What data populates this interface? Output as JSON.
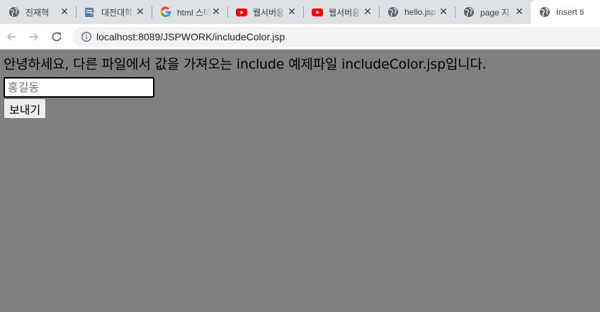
{
  "browser": {
    "tabs": [
      {
        "title": "진재혁",
        "icon": "globe-icon",
        "active": false
      },
      {
        "title": "대전대학",
        "icon": "editor-icon",
        "active": false
      },
      {
        "title": "html 스타",
        "icon": "google-icon",
        "active": false
      },
      {
        "title": "웹서버응",
        "icon": "youtube-icon",
        "active": false
      },
      {
        "title": "웹서버응",
        "icon": "youtube-icon",
        "active": false
      },
      {
        "title": "hello.jsp",
        "icon": "globe-icon",
        "active": false
      },
      {
        "title": "page 지",
        "icon": "globe-icon",
        "active": false
      },
      {
        "title": "Insert ti",
        "icon": "globe-icon",
        "active": true
      }
    ],
    "close_glyph": "✕",
    "url": "localhost:8089/JSPWORK/includeColor.jsp"
  },
  "page": {
    "heading": "안녕하세요, 다른 파일에서 값을 가져오는 include 예제파일 includeColor.jsp입니다.",
    "name_input": {
      "placeholder": "홍길동",
      "value": ""
    },
    "send_label": "보내기",
    "background_color": "#808080"
  }
}
